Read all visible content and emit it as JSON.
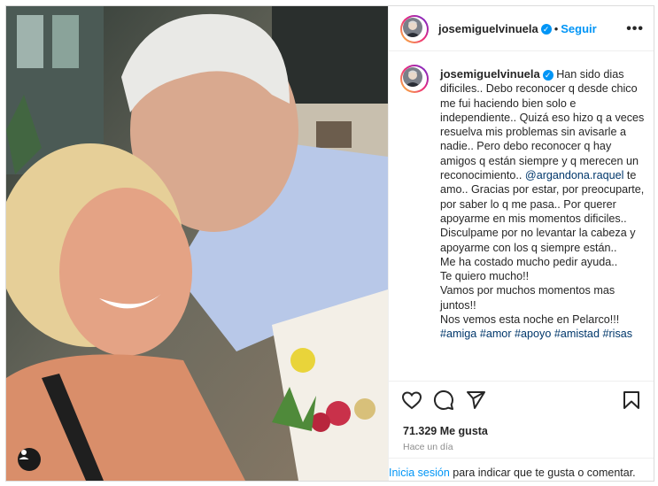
{
  "post": {
    "username": "josemiguelvinuela",
    "follow_label": "Seguir",
    "separator": "•",
    "more_label": "•••",
    "caption_parts": [
      "Han sido dias dificiles.. Debo reconocer q desde chico me fui haciendo bien solo e independiente.. Quizá eso hizo q a veces resuelva mis problemas sin avisarle a nadie.. Pero debo reconocer q hay amigos q están siempre y q merecen un reconocimiento.. ",
      "@argandona.raquel",
      " te amo.. Gracias por estar, por preocuparte, por saber lo q me pasa.. Por querer apoyarme en mis momentos dificiles..",
      "Disculpame por no levantar la cabeza y apoyarme con los q siempre están..",
      "Me ha costado mucho pedir ayuda..",
      "Te quiero mucho!!",
      "Vamos por muchos momentos mas juntos!!",
      "Nos vemos esta noche en Pelarco!!!"
    ],
    "hashtags": [
      "#amiga",
      "#amor",
      "#apoyo",
      "#amistad",
      "#risas"
    ],
    "likes": "71.329 Me gusta",
    "time_ago": "Hace un día",
    "login_link": "Inicia sesión",
    "login_text": " para indicar que te gusta o comentar."
  },
  "icons": {
    "like": "heart-icon",
    "comment": "comment-icon",
    "share": "send-icon",
    "save": "bookmark-icon",
    "tagged": "user-tag-icon",
    "verified": "verified-badge-icon"
  },
  "colors": {
    "link": "#0095f6",
    "mention": "#00376b",
    "muted": "#8e8e8e"
  }
}
